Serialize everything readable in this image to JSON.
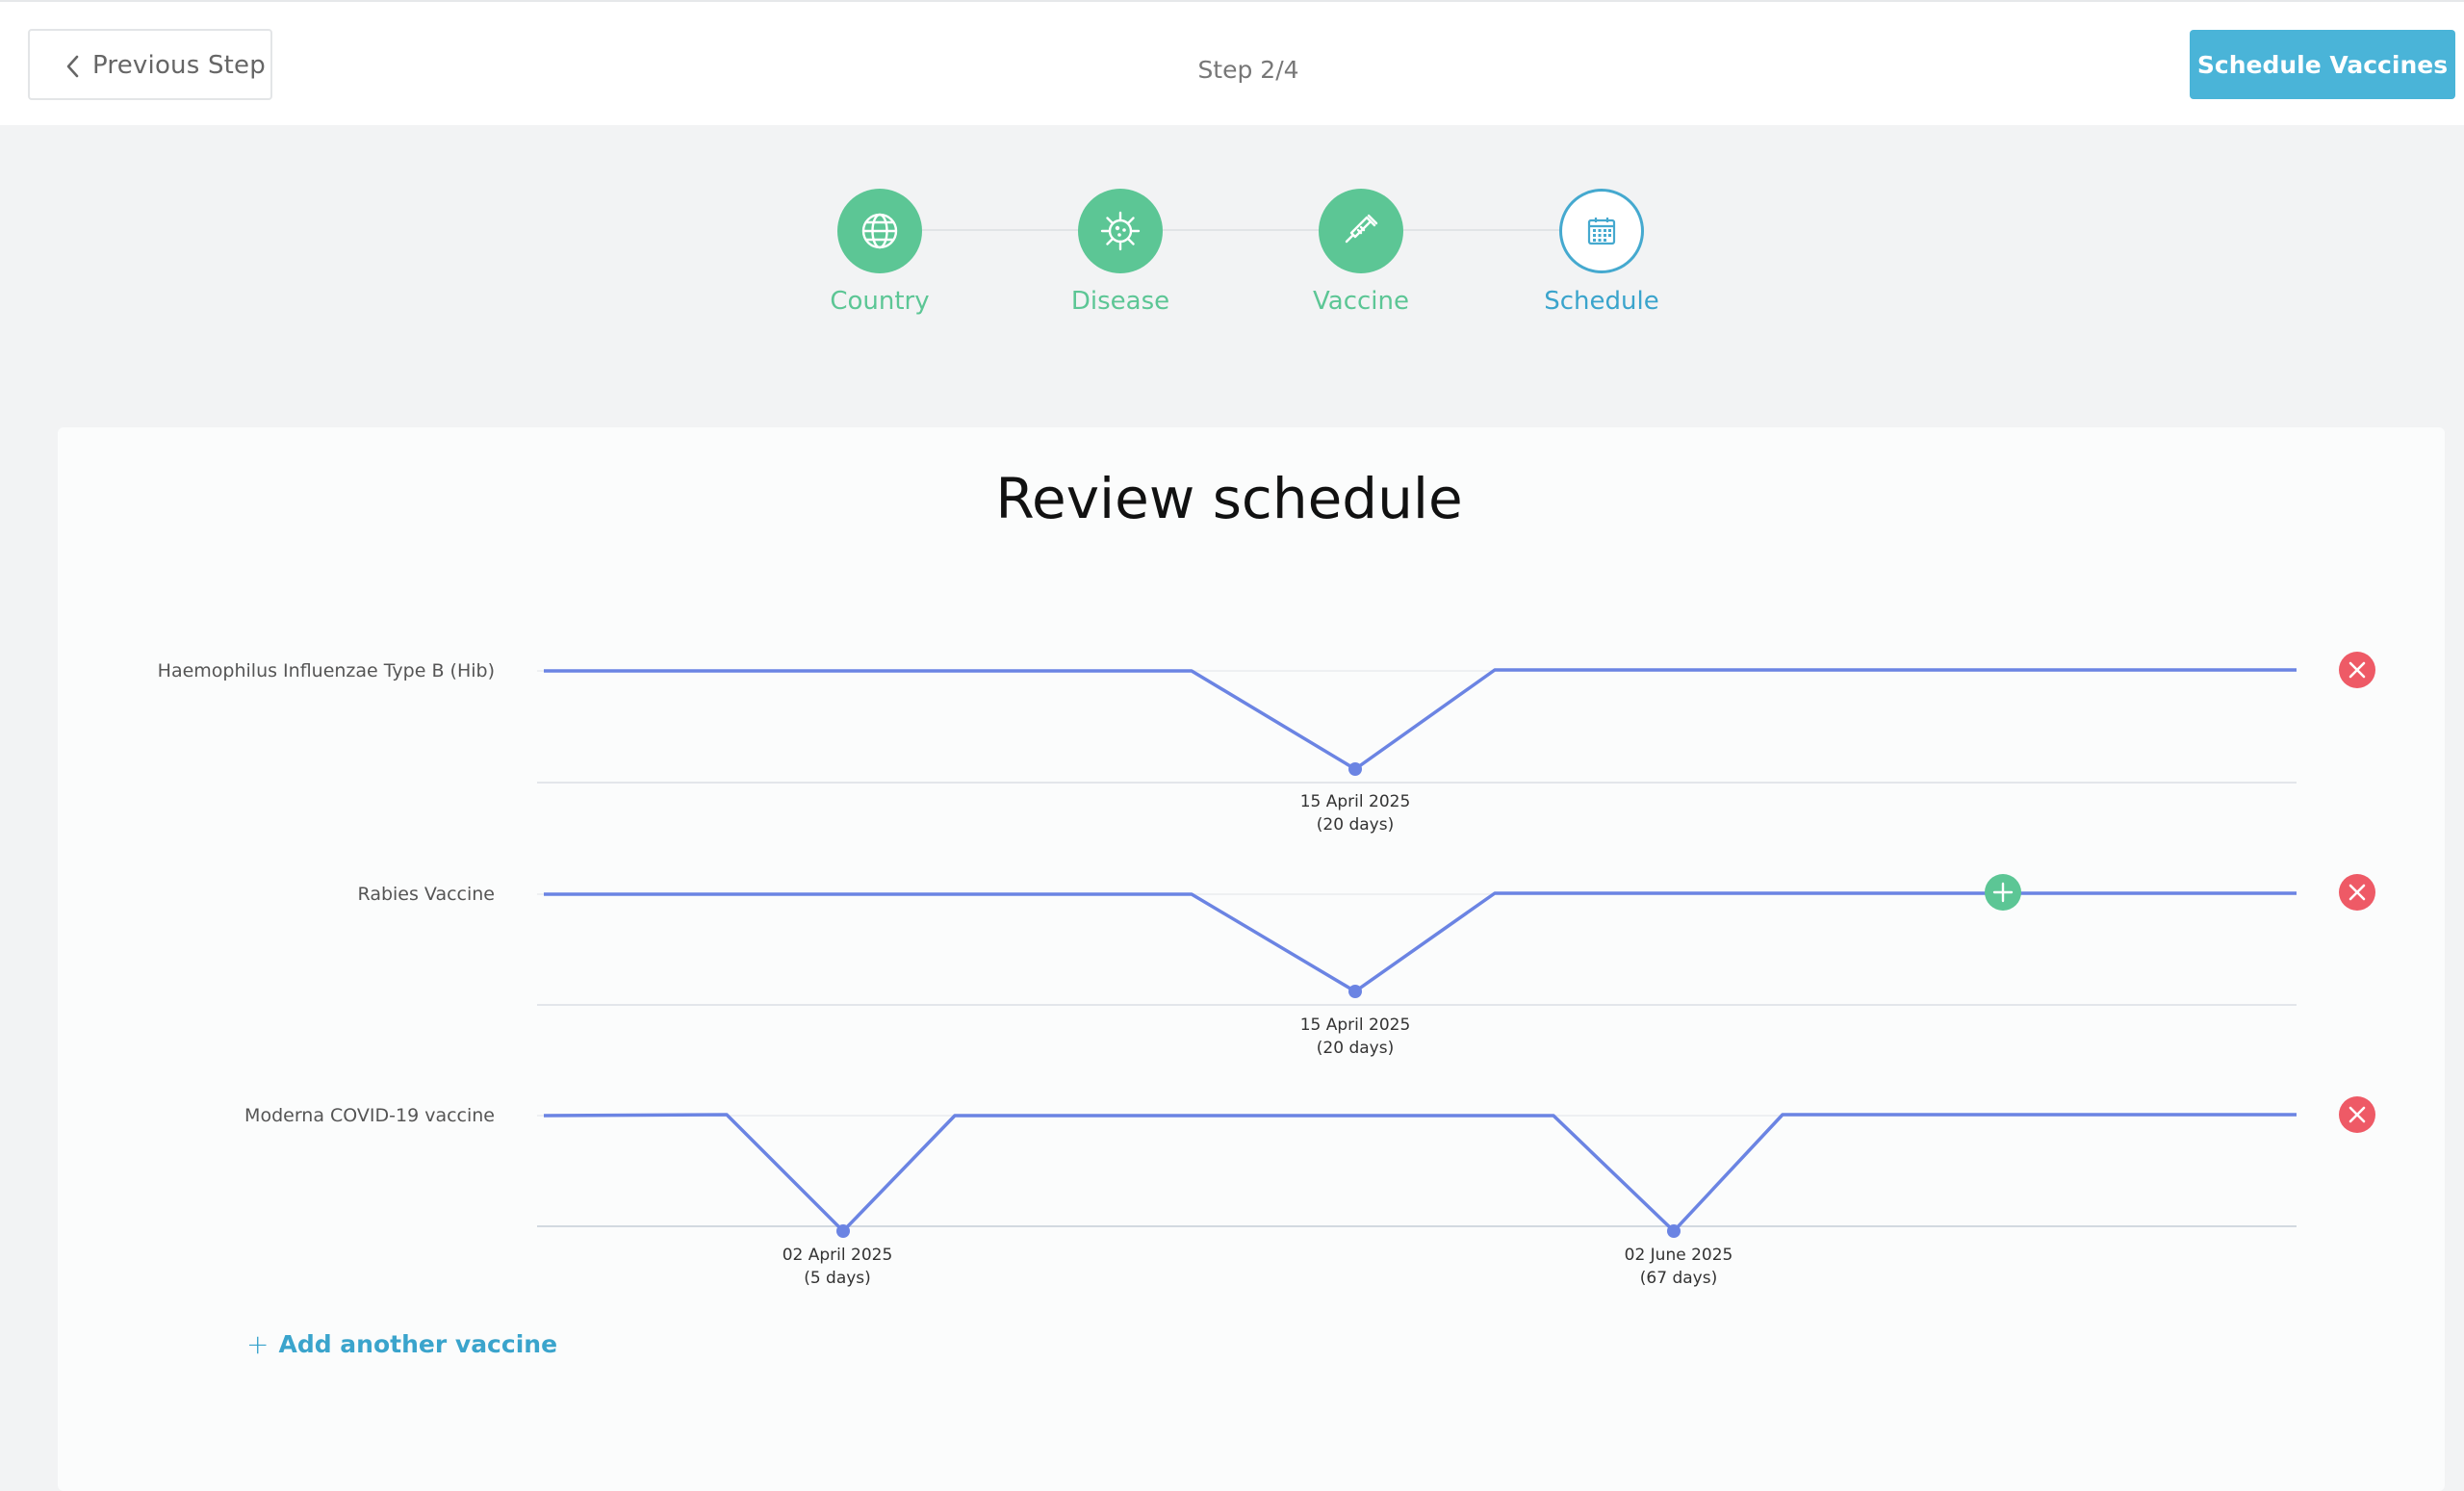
{
  "topbar": {
    "previous_label": "Previous Step",
    "step_text": "Step 2/4",
    "schedule_label": "Schedule Vaccines"
  },
  "stepper": [
    {
      "label": "Country",
      "icon": "globe-icon",
      "state": "done"
    },
    {
      "label": "Disease",
      "icon": "virus-icon",
      "state": "done"
    },
    {
      "label": "Vaccine",
      "icon": "syringe-icon",
      "state": "done"
    },
    {
      "label": "Schedule",
      "icon": "calendar-icon",
      "state": "active"
    }
  ],
  "review": {
    "title": "Review schedule",
    "add_label": "Add another vaccine",
    "rows": [
      {
        "name": "Haemophilus Influenzae Type B (Hib)",
        "doses": [
          {
            "date": "15 April 2025",
            "days": "(20 days)"
          }
        ],
        "has_add_dose": false
      },
      {
        "name": "Rabies Vaccine",
        "doses": [
          {
            "date": "15 April 2025",
            "days": "(20 days)"
          }
        ],
        "has_add_dose": true
      },
      {
        "name": "Moderna COVID-19 vaccine",
        "doses": [
          {
            "date": "02 April 2025",
            "days": "(5 days)"
          },
          {
            "date": "02 June 2025",
            "days": "(67 days)"
          }
        ],
        "has_add_dose": false
      }
    ]
  },
  "colors": {
    "accent": "#4ab4d8",
    "done_green": "#5cc695",
    "line_blue": "#6b84e3",
    "remove_red": "#ee5a66"
  }
}
